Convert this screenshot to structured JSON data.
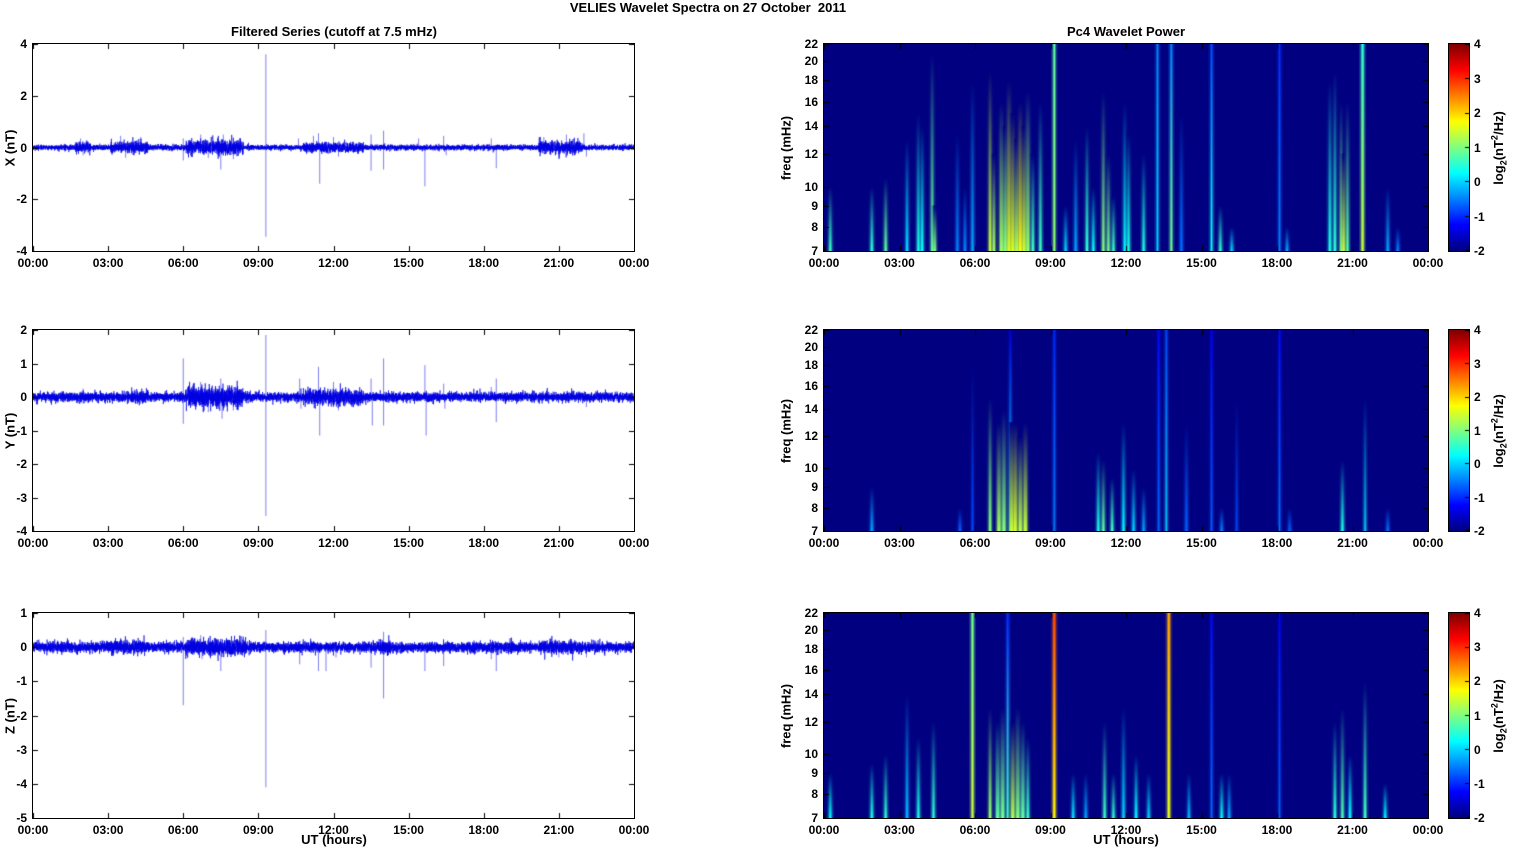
{
  "figure_title": "VELIES Wavelet Spectra on 27 October  2011",
  "left_column_title": "Filtered Series (cutoff at 7.5 mHz)",
  "right_column_title": "Pc4 Wavelet Power",
  "xlabel": "UT (hours)",
  "time_ticks": [
    "00:00",
    "03:00",
    "06:00",
    "09:00",
    "12:00",
    "15:00",
    "18:00",
    "21:00",
    "00:00"
  ],
  "time_tick_hours": [
    0,
    3,
    6,
    9,
    12,
    15,
    18,
    21,
    24
  ],
  "time_lim": [
    0,
    24
  ],
  "colors": {
    "background": "#ffffff",
    "axis": "#000000",
    "series_line": "#0000e0",
    "heatmap_background": "#000084"
  },
  "colorbar": {
    "clim": [
      -2,
      4
    ],
    "ticks": [
      4,
      3,
      2,
      1,
      0,
      -1,
      -2
    ],
    "label": {
      "pre": "log",
      "sub": "2",
      "mid": "(nT",
      "sup": "2",
      "post": "/Hz)"
    }
  },
  "chart_data": [
    {
      "id": "x-filtered-series",
      "type": "line",
      "column": "left",
      "row": 0,
      "ylabel": "X (nT)",
      "ylim": [
        -4,
        4
      ],
      "yticks": [
        4,
        2,
        0,
        -2,
        -4
      ],
      "noise_std": 0.05,
      "seed": 11,
      "bursts": [
        [
          1.7,
          2.3,
          0.1
        ],
        [
          3.1,
          4.6,
          0.11
        ],
        [
          6.1,
          8.4,
          0.14
        ],
        [
          10.8,
          13.2,
          0.1
        ],
        [
          20.2,
          21.9,
          0.13
        ]
      ],
      "spikes": [
        [
          1.9,
          0.35
        ],
        [
          2.0,
          -0.3
        ],
        [
          3.5,
          0.45
        ],
        [
          3.7,
          -0.4
        ],
        [
          4.3,
          0.4
        ],
        [
          6.0,
          0.35
        ],
        [
          6.0,
          -0.5
        ],
        [
          6.7,
          0.5
        ],
        [
          7.0,
          -0.4
        ],
        [
          7.5,
          -0.85
        ],
        [
          7.6,
          0.5
        ],
        [
          8.0,
          -0.45
        ],
        [
          9.3,
          3.6
        ],
        [
          9.3,
          -3.45
        ],
        [
          10.6,
          0.35
        ],
        [
          11.2,
          0.45
        ],
        [
          11.4,
          0.55
        ],
        [
          11.45,
          -1.4
        ],
        [
          12.0,
          0.4
        ],
        [
          12.2,
          -0.35
        ],
        [
          13.5,
          0.5
        ],
        [
          13.5,
          -0.9
        ],
        [
          14.0,
          0.65
        ],
        [
          14.0,
          -0.85
        ],
        [
          15.4,
          0.35
        ],
        [
          15.65,
          -1.5
        ],
        [
          16.4,
          0.45
        ],
        [
          16.5,
          -0.3
        ],
        [
          18.3,
          0.35
        ],
        [
          18.5,
          -0.8
        ],
        [
          20.4,
          0.4
        ],
        [
          21.0,
          -0.45
        ],
        [
          21.3,
          0.5
        ],
        [
          22.0,
          0.55
        ],
        [
          22.1,
          -0.35
        ]
      ]
    },
    {
      "id": "y-filtered-series",
      "type": "line",
      "column": "left",
      "row": 1,
      "ylabel": "Y (nT)",
      "ylim": [
        -4,
        2
      ],
      "yticks": [
        2,
        1,
        0,
        -1,
        -2,
        -3,
        -4
      ],
      "noise_std": 0.07,
      "seed": 22,
      "bursts": [
        [
          3.9,
          4.6,
          0.09
        ],
        [
          6.1,
          8.4,
          0.16
        ],
        [
          10.8,
          13.2,
          0.12
        ]
      ],
      "spikes": [
        [
          2.0,
          0.25
        ],
        [
          2.0,
          -0.2
        ],
        [
          6.0,
          1.15
        ],
        [
          6.0,
          -0.8
        ],
        [
          6.7,
          0.45
        ],
        [
          7.0,
          -0.45
        ],
        [
          7.5,
          0.55
        ],
        [
          7.55,
          -0.65
        ],
        [
          8.0,
          -0.4
        ],
        [
          9.3,
          1.85
        ],
        [
          9.3,
          -3.55
        ],
        [
          10.65,
          0.55
        ],
        [
          10.7,
          -0.35
        ],
        [
          11.4,
          0.9
        ],
        [
          11.45,
          -1.15
        ],
        [
          12.0,
          0.45
        ],
        [
          12.2,
          -0.4
        ],
        [
          13.5,
          0.55
        ],
        [
          13.55,
          -0.85
        ],
        [
          14.0,
          1.15
        ],
        [
          14.0,
          -0.85
        ],
        [
          15.65,
          0.95
        ],
        [
          15.7,
          -1.15
        ],
        [
          16.4,
          0.4
        ],
        [
          16.45,
          -0.35
        ],
        [
          18.3,
          0.3
        ],
        [
          18.5,
          0.55
        ],
        [
          18.5,
          -0.75
        ],
        [
          22.1,
          -0.3
        ]
      ]
    },
    {
      "id": "z-filtered-series",
      "type": "line",
      "column": "left",
      "row": 2,
      "ylabel": "Z (nT)",
      "ylim": [
        -5,
        1
      ],
      "yticks": [
        1,
        0,
        -1,
        -2,
        -3,
        -4,
        -5
      ],
      "noise_std": 0.075,
      "seed": 33,
      "bursts": [
        [
          3.0,
          4.5,
          0.1
        ],
        [
          6.1,
          8.5,
          0.12
        ],
        [
          13.8,
          14.3,
          0.1
        ],
        [
          20.2,
          21.9,
          0.1
        ]
      ],
      "spikes": [
        [
          6.0,
          0.3
        ],
        [
          6.0,
          -1.7
        ],
        [
          6.7,
          0.35
        ],
        [
          6.75,
          -0.35
        ],
        [
          7.5,
          -0.7
        ],
        [
          9.3,
          0.5
        ],
        [
          9.3,
          -4.1
        ],
        [
          10.65,
          -0.5
        ],
        [
          11.4,
          -0.7
        ],
        [
          11.7,
          -0.7
        ],
        [
          12.1,
          -0.3
        ],
        [
          13.5,
          -0.6
        ],
        [
          14.0,
          0.45
        ],
        [
          14.0,
          -1.5
        ],
        [
          15.65,
          -0.7
        ],
        [
          16.4,
          -0.55
        ],
        [
          18.3,
          -0.35
        ],
        [
          18.5,
          -0.7
        ],
        [
          21.0,
          -0.3
        ],
        [
          22.1,
          -0.3
        ]
      ]
    },
    {
      "id": "x-wavelet-power",
      "type": "heatmap",
      "column": "right",
      "row": 0,
      "ylabel": "freq (mHz)",
      "yscale": "log",
      "ylim": [
        7,
        22
      ],
      "yticks": [
        22,
        20,
        18,
        16,
        14,
        12,
        10,
        9,
        8,
        7
      ],
      "events": [
        [
          0.25,
          10,
          0.6
        ],
        [
          1.9,
          10,
          0.5
        ],
        [
          2.45,
          10.5,
          0.8
        ],
        [
          3.3,
          13,
          0.0
        ],
        [
          3.75,
          15,
          0.4
        ],
        [
          3.9,
          14,
          0.3
        ],
        [
          4.3,
          21,
          0.8
        ],
        [
          4.4,
          9,
          1.0
        ],
        [
          5.3,
          13.5,
          -0.5
        ],
        [
          5.6,
          10,
          -0.5
        ],
        [
          5.9,
          18,
          -0.3
        ],
        [
          6.6,
          19,
          1.4
        ],
        [
          6.75,
          12,
          1.2
        ],
        [
          7.05,
          16,
          1.2,
          -2,
          3
        ],
        [
          7.2,
          14,
          1.0,
          -2,
          3
        ],
        [
          7.35,
          18,
          1.5,
          -2,
          3
        ],
        [
          7.5,
          15,
          1.6,
          -2,
          3
        ],
        [
          7.65,
          13,
          1.2,
          -2,
          3
        ],
        [
          7.8,
          16,
          1.7,
          -2,
          3
        ],
        [
          7.95,
          14,
          1.5,
          -2,
          3
        ],
        [
          8.1,
          17,
          1.1,
          -2,
          3
        ],
        [
          8.3,
          12,
          0.6
        ],
        [
          8.6,
          16,
          0.6
        ],
        [
          9.15,
          22,
          1.1,
          0.8,
          1.5
        ],
        [
          9.6,
          9,
          0.0
        ],
        [
          10.0,
          13,
          -0.3
        ],
        [
          10.45,
          14,
          0.5
        ],
        [
          10.7,
          10,
          0.3
        ],
        [
          11.1,
          17,
          1.0
        ],
        [
          11.3,
          12,
          0.9
        ],
        [
          11.5,
          9.5,
          0.6
        ],
        [
          11.95,
          16,
          0.2
        ],
        [
          12.1,
          13.5,
          0.4
        ],
        [
          12.7,
          12,
          0.4
        ],
        [
          13.25,
          22,
          0.0,
          -0.5,
          1.2
        ],
        [
          13.8,
          22,
          0.9,
          -0.5,
          1.5
        ],
        [
          14.2,
          15,
          -0.6
        ],
        [
          15.4,
          22,
          0.3,
          -0.8,
          1.2
        ],
        [
          15.75,
          9,
          0.5
        ],
        [
          16.2,
          8,
          0.0
        ],
        [
          18.1,
          22,
          -0.5,
          -1.0,
          1.2
        ],
        [
          18.4,
          8,
          -0.3
        ],
        [
          20.1,
          18,
          0.4
        ],
        [
          20.3,
          19,
          0.5
        ],
        [
          20.55,
          16,
          0.9
        ],
        [
          20.65,
          12,
          1.5
        ],
        [
          20.8,
          16,
          0.8
        ],
        [
          21.4,
          22,
          1.4,
          0.5,
          2
        ],
        [
          22.4,
          10,
          -0.3
        ],
        [
          22.8,
          8,
          -0.5
        ]
      ]
    },
    {
      "id": "y-wavelet-power",
      "type": "heatmap",
      "column": "right",
      "row": 1,
      "ylabel": "freq (mHz)",
      "yscale": "log",
      "ylim": [
        7,
        22
      ],
      "yticks": [
        22,
        20,
        18,
        16,
        14,
        12,
        10,
        9,
        8,
        7
      ],
      "events": [
        [
          1.9,
          9,
          -0.3
        ],
        [
          5.4,
          8,
          -0.7
        ],
        [
          5.9,
          18,
          -0.8,
          -2,
          1
        ],
        [
          6.6,
          15,
          1.0
        ],
        [
          6.95,
          13,
          1.2,
          -2,
          3
        ],
        [
          7.15,
          14,
          1.0,
          -2,
          3
        ],
        [
          7.4,
          22,
          0.2,
          -1.5,
          1
        ],
        [
          7.45,
          13,
          1.4,
          -2,
          3
        ],
        [
          7.6,
          13,
          1.5,
          -2,
          3
        ],
        [
          7.8,
          12,
          1.3,
          -2,
          3
        ],
        [
          8.0,
          13,
          1.4,
          -2,
          3
        ],
        [
          9.15,
          22,
          -0.5,
          -1.0,
          1
        ],
        [
          10.9,
          11,
          0.4
        ],
        [
          11.1,
          10.5,
          0.8
        ],
        [
          11.45,
          9.5,
          0.6
        ],
        [
          11.9,
          13,
          0.2
        ],
        [
          12.3,
          10,
          0.0
        ],
        [
          12.7,
          9,
          -0.3
        ],
        [
          13.3,
          22,
          -0.6,
          -1.2,
          1
        ],
        [
          13.6,
          22,
          0.0,
          -0.8,
          1
        ],
        [
          14.4,
          13,
          -0.7
        ],
        [
          15.4,
          22,
          -0.7,
          -1.3,
          1
        ],
        [
          15.8,
          8,
          -0.5
        ],
        [
          16.4,
          15,
          -0.8,
          -2,
          1
        ],
        [
          18.1,
          22,
          -0.6,
          -1.2,
          1
        ],
        [
          18.5,
          8,
          -0.7
        ],
        [
          20.6,
          10.5,
          0.4
        ],
        [
          21.5,
          15,
          0.1,
          -2,
          1
        ],
        [
          22.4,
          8,
          -0.6
        ]
      ]
    },
    {
      "id": "z-wavelet-power",
      "type": "heatmap",
      "column": "right",
      "row": 2,
      "ylabel": "freq (mHz)",
      "yscale": "log",
      "ylim": [
        7,
        22
      ],
      "yticks": [
        22,
        20,
        18,
        16,
        14,
        12,
        10,
        9,
        8,
        7
      ],
      "events": [
        [
          0.25,
          9,
          0.3
        ],
        [
          1.9,
          9.5,
          0.4
        ],
        [
          2.45,
          10,
          0.5
        ],
        [
          3.3,
          14,
          -0.2
        ],
        [
          3.75,
          11,
          0.4
        ],
        [
          4.35,
          12,
          0.5
        ],
        [
          5.9,
          22,
          1.4,
          0.9,
          1.8
        ],
        [
          6.6,
          13,
          1.1
        ],
        [
          6.9,
          12,
          0.8,
          -2,
          3
        ],
        [
          7.1,
          13,
          0.9,
          -2,
          3
        ],
        [
          7.3,
          22,
          0.6,
          -1.0,
          1.5
        ],
        [
          7.5,
          12,
          1.3,
          -2,
          3
        ],
        [
          7.7,
          13,
          1.0,
          -2,
          3
        ],
        [
          7.9,
          12,
          0.8,
          -2,
          3
        ],
        [
          8.1,
          11,
          0.6
        ],
        [
          9.15,
          22,
          1.8,
          2.8,
          2
        ],
        [
          9.9,
          9,
          0.1
        ],
        [
          10.4,
          9,
          -0.3
        ],
        [
          11.15,
          12,
          0.6
        ],
        [
          11.5,
          9,
          0.5
        ],
        [
          11.9,
          13,
          0.0
        ],
        [
          12.4,
          10,
          0.2
        ],
        [
          12.9,
          9,
          0.0
        ],
        [
          13.7,
          22,
          1.6,
          2.3,
          2
        ],
        [
          14.5,
          9,
          -0.2
        ],
        [
          15.4,
          22,
          -0.6,
          -1.2,
          1
        ],
        [
          15.8,
          9,
          0.3
        ],
        [
          16.1,
          9,
          -0.3
        ],
        [
          18.1,
          22,
          -0.7,
          -1.3,
          1
        ],
        [
          20.3,
          12,
          0.5
        ],
        [
          20.6,
          13,
          0.7
        ],
        [
          20.9,
          10,
          0.2
        ],
        [
          21.5,
          15,
          0.6
        ],
        [
          22.3,
          8.5,
          0.2
        ]
      ]
    }
  ]
}
